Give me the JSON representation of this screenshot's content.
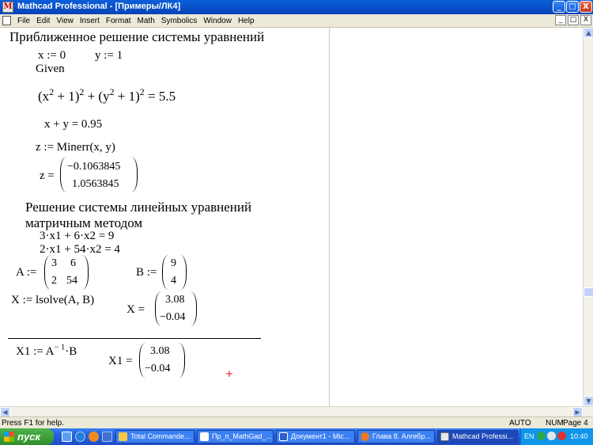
{
  "window": {
    "title": "Mathcad Professional - [Примеры/ЛК4]",
    "app_icon": "mathcad-logo-icon",
    "controls": [
      "_",
      "□",
      "X"
    ]
  },
  "menu": {
    "items": [
      "File",
      "Edit",
      "View",
      "Insert",
      "Format",
      "Math",
      "Symbolics",
      "Window",
      "Help"
    ],
    "doc_controls": [
      "_",
      "□",
      "X"
    ]
  },
  "sheet": {
    "heading1": "Приближенное решение системы уравнений",
    "x_def": "x := 0",
    "y_def": "y := 1",
    "given": "Given",
    "eq1_a": "(x",
    "eq1_b": "2",
    "eq1_c": " + 1)",
    "eq1_d": "2",
    "eq1_e": " + (y",
    "eq1_f": "2",
    "eq1_g": " + 1)",
    "eq1_h": "2",
    "eq1_i": " = 5.5",
    "eq2": "x + y = 0.95",
    "z_def": "z := Minerr(x, y)",
    "z_eq": "z =",
    "z_vec": [
      "−0.1063845",
      "1.0563845"
    ],
    "heading2_line1": "Решение системы линейных уравнений",
    "heading2_line2": "матричным методом",
    "lin1": "3·x1 + 6·x2 = 9",
    "lin2": "2·x1 + 54·x2 = 4",
    "A_def": "A :=",
    "A_matrix": [
      [
        "3",
        "6"
      ],
      [
        "2",
        "54"
      ]
    ],
    "B_def": "B :=",
    "B_vec": [
      "9",
      "4"
    ],
    "X_def": "X := lsolve(A, B)",
    "X_eq": "X =",
    "X_vec": [
      "3.08",
      "−0.04"
    ],
    "X1_def_a": "X1 := A",
    "X1_def_b": "− 1",
    "X1_def_c": "·B",
    "X1_eq": "X1 =",
    "X1_vec": [
      "3.08",
      "−0.04"
    ],
    "cursor": "+"
  },
  "status": {
    "help": "Press F1 for help.",
    "mode": "AUTO",
    "num": "NUM",
    "page": "Page 4"
  },
  "taskbar": {
    "start": "пуск",
    "tasks": [
      "Total Commande...",
      "Пр_п_MathGad_...",
      "Документ1 - Mic...",
      "Глава 8. Алгебр...",
      "Mathcad Professi..."
    ],
    "lang": "EN",
    "clock": "10:40"
  },
  "colors": {
    "titlebar": "#0a5fd8",
    "taskbar": "#245edb",
    "start": "#3c9a36",
    "cursor": "#e00000"
  }
}
